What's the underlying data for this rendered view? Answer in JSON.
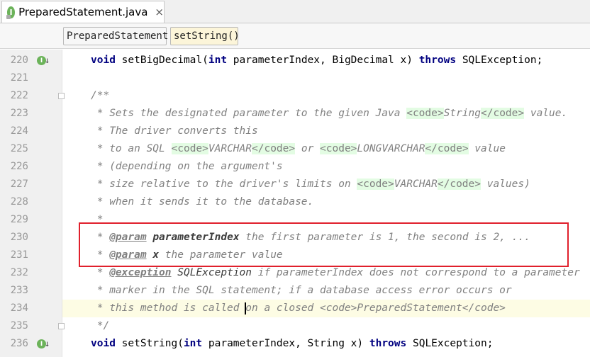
{
  "tab": {
    "icon_letter": "I",
    "title": "PreparedStatement.java",
    "close": "×"
  },
  "breadcrumb": {
    "items": [
      "PreparedStatement",
      "setString()"
    ]
  },
  "editor": {
    "active_line": 234,
    "lines": [
      {
        "n": "220",
        "segs": [
          [
            "kw",
            "void"
          ],
          [
            "p",
            " setBigDecimal("
          ],
          [
            "kw",
            "int"
          ],
          [
            "p",
            " parameterIndex, BigDecimal x) "
          ],
          [
            "kw",
            "throws"
          ],
          [
            "p",
            " SQLException;"
          ]
        ]
      },
      {
        "n": "221",
        "segs": []
      },
      {
        "n": "222",
        "segs": [
          [
            "doc",
            "/**"
          ]
        ]
      },
      {
        "n": "223",
        "segs": [
          [
            "doc",
            " * Sets the designated parameter to the given Java "
          ],
          [
            "tag",
            "<code>"
          ],
          [
            "doc",
            "String"
          ],
          [
            "tag",
            "</code>"
          ],
          [
            "doc",
            " value."
          ]
        ]
      },
      {
        "n": "224",
        "segs": [
          [
            "doc",
            " * The driver converts this"
          ]
        ]
      },
      {
        "n": "225",
        "segs": [
          [
            "doc",
            " * to an SQL "
          ],
          [
            "tag",
            "<code>"
          ],
          [
            "doc",
            "VARCHAR"
          ],
          [
            "tag",
            "</code>"
          ],
          [
            "doc",
            " or "
          ],
          [
            "tag",
            "<code>"
          ],
          [
            "doc",
            "LONGVARCHAR"
          ],
          [
            "tag",
            "</code>"
          ],
          [
            "doc",
            " value"
          ]
        ]
      },
      {
        "n": "226",
        "segs": [
          [
            "doc",
            " * (depending on the argument's"
          ]
        ]
      },
      {
        "n": "227",
        "segs": [
          [
            "doc",
            " * size relative to the driver's limits on "
          ],
          [
            "tag",
            "<code>"
          ],
          [
            "doc",
            "VARCHAR"
          ],
          [
            "tag",
            "</code>"
          ],
          [
            "doc",
            " values)"
          ]
        ]
      },
      {
        "n": "228",
        "segs": [
          [
            "doc",
            " * when it sends it to the database."
          ]
        ]
      },
      {
        "n": "229",
        "segs": [
          [
            "doc",
            " *"
          ]
        ]
      },
      {
        "n": "230",
        "segs": [
          [
            "doc",
            " * "
          ],
          [
            "dtag",
            "@param"
          ],
          [
            "doc",
            " "
          ],
          [
            "dparam",
            "parameterIndex"
          ],
          [
            "doc",
            " the first parameter is 1, the second is 2, ..."
          ]
        ]
      },
      {
        "n": "231",
        "segs": [
          [
            "doc",
            " * "
          ],
          [
            "dtag",
            "@param"
          ],
          [
            "doc",
            " "
          ],
          [
            "dparam",
            "x"
          ],
          [
            "doc",
            " the parameter value"
          ]
        ]
      },
      {
        "n": "232",
        "segs": [
          [
            "doc",
            " * "
          ],
          [
            "dtag",
            "@exception"
          ],
          [
            "doc",
            " "
          ],
          [
            "dref",
            "SQLException"
          ],
          [
            "doc",
            " if parameterIndex does not correspond to a parameter"
          ]
        ]
      },
      {
        "n": "233",
        "segs": [
          [
            "doc",
            " * marker in the SQL statement; if a database access error occurs or"
          ]
        ]
      },
      {
        "n": "234",
        "segs": [
          [
            "doc",
            " * this method is called "
          ],
          [
            "caret",
            ""
          ],
          [
            "doc",
            "on a closed <code>PreparedStatement</code>"
          ]
        ]
      },
      {
        "n": "235",
        "segs": [
          [
            "doc",
            " */"
          ]
        ]
      },
      {
        "n": "236",
        "segs": [
          [
            "kw",
            "void"
          ],
          [
            "p",
            " setString("
          ],
          [
            "kw",
            "int"
          ],
          [
            "p",
            " parameterIndex, String x) "
          ],
          [
            "kw",
            "throws"
          ],
          [
            "p",
            " SQLException;"
          ]
        ]
      }
    ]
  },
  "gutter_marks": {
    "220": "I",
    "236": "I"
  },
  "colors": {
    "keyword": "#000080",
    "doc_comment": "#808080",
    "code_tag_bg": "#e3fce3",
    "current_line": "#fdfce4",
    "annotation_box": "#e0202c"
  }
}
